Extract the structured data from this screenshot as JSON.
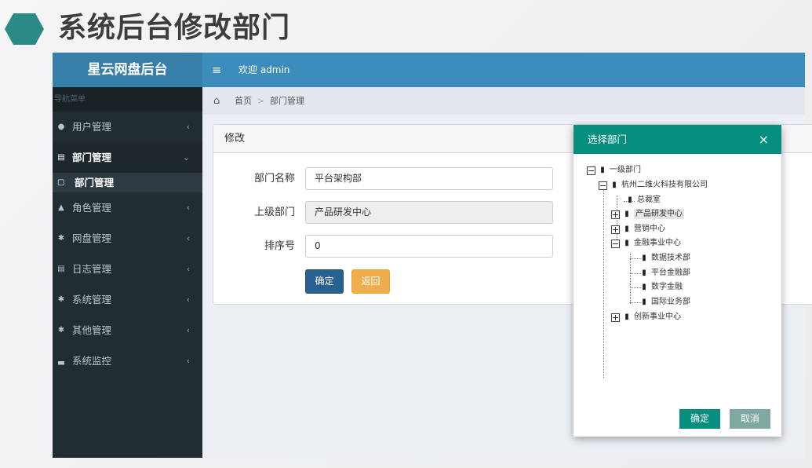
{
  "slide": {
    "title": "系统后台修改部门"
  },
  "app": {
    "logo": "星云网盘后台",
    "topbar": {
      "menu_icon": "≡",
      "welcome": "欢迎 admin"
    },
    "sidebar": {
      "header": "导航菜单",
      "items": [
        {
          "label": "用户管理",
          "icon": "user-icon",
          "chevron": "‹",
          "open": false
        },
        {
          "label": "部门管理",
          "icon": "id-card-icon",
          "chevron": "⌄",
          "open": true,
          "children": [
            {
              "label": "部门管理",
              "icon": "document-icon"
            }
          ]
        },
        {
          "label": "角色管理",
          "icon": "user-group-icon",
          "chevron": "‹",
          "open": false
        },
        {
          "label": "网盘管理",
          "icon": "gear-icon",
          "chevron": "‹",
          "open": false
        },
        {
          "label": "日志管理",
          "icon": "file-text-icon",
          "chevron": "‹",
          "open": false
        },
        {
          "label": "系统管理",
          "icon": "gear-icon",
          "chevron": "‹",
          "open": false
        },
        {
          "label": "其他管理",
          "icon": "gear-icon",
          "chevron": "‹",
          "open": false
        },
        {
          "label": "系统监控",
          "icon": "bar-chart-icon",
          "chevron": "‹",
          "open": false
        }
      ]
    },
    "breadcrumb": {
      "home_icon": "home-icon",
      "items": [
        "首页",
        "部门管理"
      ],
      "separator": ">"
    },
    "form": {
      "title": "修改",
      "fields": {
        "name": {
          "label": "部门名称",
          "value": "平台架构部"
        },
        "parent": {
          "label": "上级部门",
          "value": "产品研发中心"
        },
        "order": {
          "label": "排序号",
          "value": "0"
        }
      },
      "buttons": {
        "confirm": "确定",
        "back": "返回"
      }
    },
    "modal": {
      "title": "选择部门",
      "close": "×",
      "tree": [
        {
          "label": "一级部门",
          "type": "folder-open",
          "switch": "minus"
        },
        {
          "label": "杭州二维火科技有限公司",
          "type": "folder-open",
          "switch": "minus"
        },
        {
          "label": "总裁室",
          "type": "file"
        },
        {
          "label": "产品研发中心",
          "type": "folder",
          "switch": "plus",
          "selected": true
        },
        {
          "label": "营销中心",
          "type": "folder",
          "switch": "plus"
        },
        {
          "label": "金融事业中心",
          "type": "folder-open",
          "switch": "minus"
        },
        {
          "label": "数据技术部",
          "type": "file"
        },
        {
          "label": "平台金融部",
          "type": "file"
        },
        {
          "label": "数字金融",
          "type": "file"
        },
        {
          "label": "国际业务部",
          "type": "file"
        },
        {
          "label": "创新事业中心",
          "type": "folder",
          "switch": "plus"
        }
      ],
      "buttons": {
        "confirm": "确定",
        "cancel": "取消"
      }
    }
  }
}
